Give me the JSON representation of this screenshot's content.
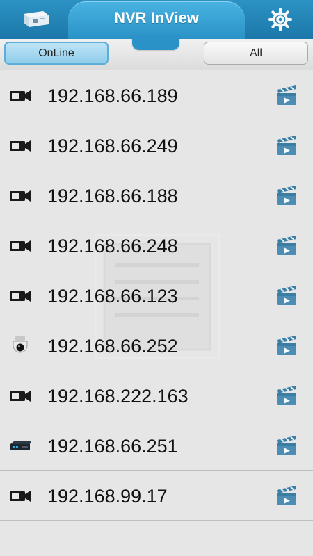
{
  "header": {
    "title": "NVR InView",
    "left_icon": "nvr-device-icon",
    "right_icon": "gear-icon"
  },
  "filters": {
    "online_label": "OnLine",
    "all_label": "All",
    "selected": "OnLine"
  },
  "devices": [
    {
      "ip": "192.168.66.189",
      "type_icon": "camera-icon"
    },
    {
      "ip": "192.168.66.249",
      "type_icon": "camera-icon"
    },
    {
      "ip": "192.168.66.188",
      "type_icon": "camera-icon"
    },
    {
      "ip": "192.168.66.248",
      "type_icon": "camera-icon"
    },
    {
      "ip": "192.168.66.123",
      "type_icon": "camera-icon"
    },
    {
      "ip": "192.168.66.252",
      "type_icon": "dome-camera-icon"
    },
    {
      "ip": "192.168.222.163",
      "type_icon": "camera-icon"
    },
    {
      "ip": "192.168.66.251",
      "type_icon": "nvr-recorder-icon"
    },
    {
      "ip": "192.168.99.17",
      "type_icon": "camera-icon"
    }
  ],
  "colors": {
    "header_blue": "#2a92c6",
    "selected_blue": "#8fcde9",
    "row_bg": "#e6e6e6"
  }
}
